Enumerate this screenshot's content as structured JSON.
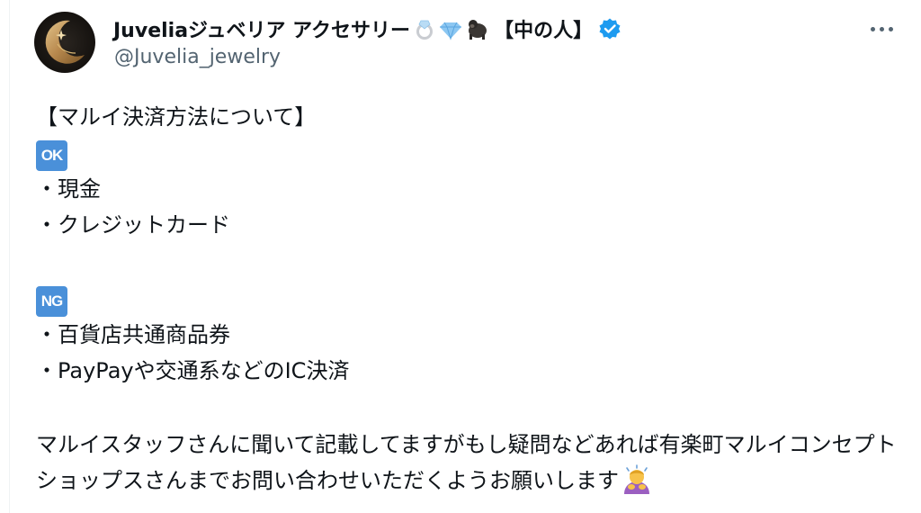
{
  "author": {
    "name": "Juveliaジュベリア アクセサリー",
    "name_suffix": "【中の人】",
    "name_emojis": [
      "ring-icon",
      "gem-icon",
      "gorilla-icon"
    ],
    "handle": "@Juvelia_jewelry",
    "verified": true,
    "verified_color": "#1d9bf0"
  },
  "tweet": {
    "title": "【マルイ決済方法について】",
    "ok_badge": "OK",
    "ok_items": [
      "・現金",
      "・クレジットカード"
    ],
    "ng_badge": "NG",
    "ng_items": [
      "・百貨店共通商品券",
      "・PayPayや交通系などのIC決済"
    ],
    "paragraph": "マルイスタッフさんに聞いて記載してますがもし疑問などあれば有楽町マルイコンセプトショップスさんまでお問い合わせいただくようお願いします"
  },
  "colors": {
    "text": "#0f1419",
    "secondary": "#536471",
    "badge": "#4a90d9"
  }
}
